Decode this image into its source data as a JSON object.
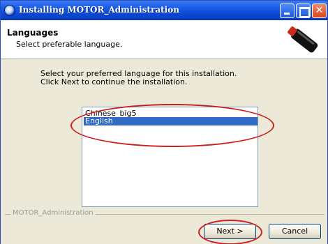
{
  "window": {
    "title": "Installing MOTOR_Administration"
  },
  "header": {
    "title": "Languages",
    "subtitle": "Select preferable language."
  },
  "body": {
    "instruction_line1": "Select your preferred language for this installation.",
    "instruction_line2": "Click Next to continue the installation.",
    "languages": [
      {
        "label": "Chinese_big5",
        "selected": false
      },
      {
        "label": "English",
        "selected": true
      }
    ],
    "group_label": "MOTOR_Administration"
  },
  "buttons": {
    "next": "Next >",
    "cancel": "Cancel"
  },
  "colors": {
    "titlebar": "#0a48d6",
    "selection": "#316ac5",
    "annotation": "#cc1f1f"
  }
}
